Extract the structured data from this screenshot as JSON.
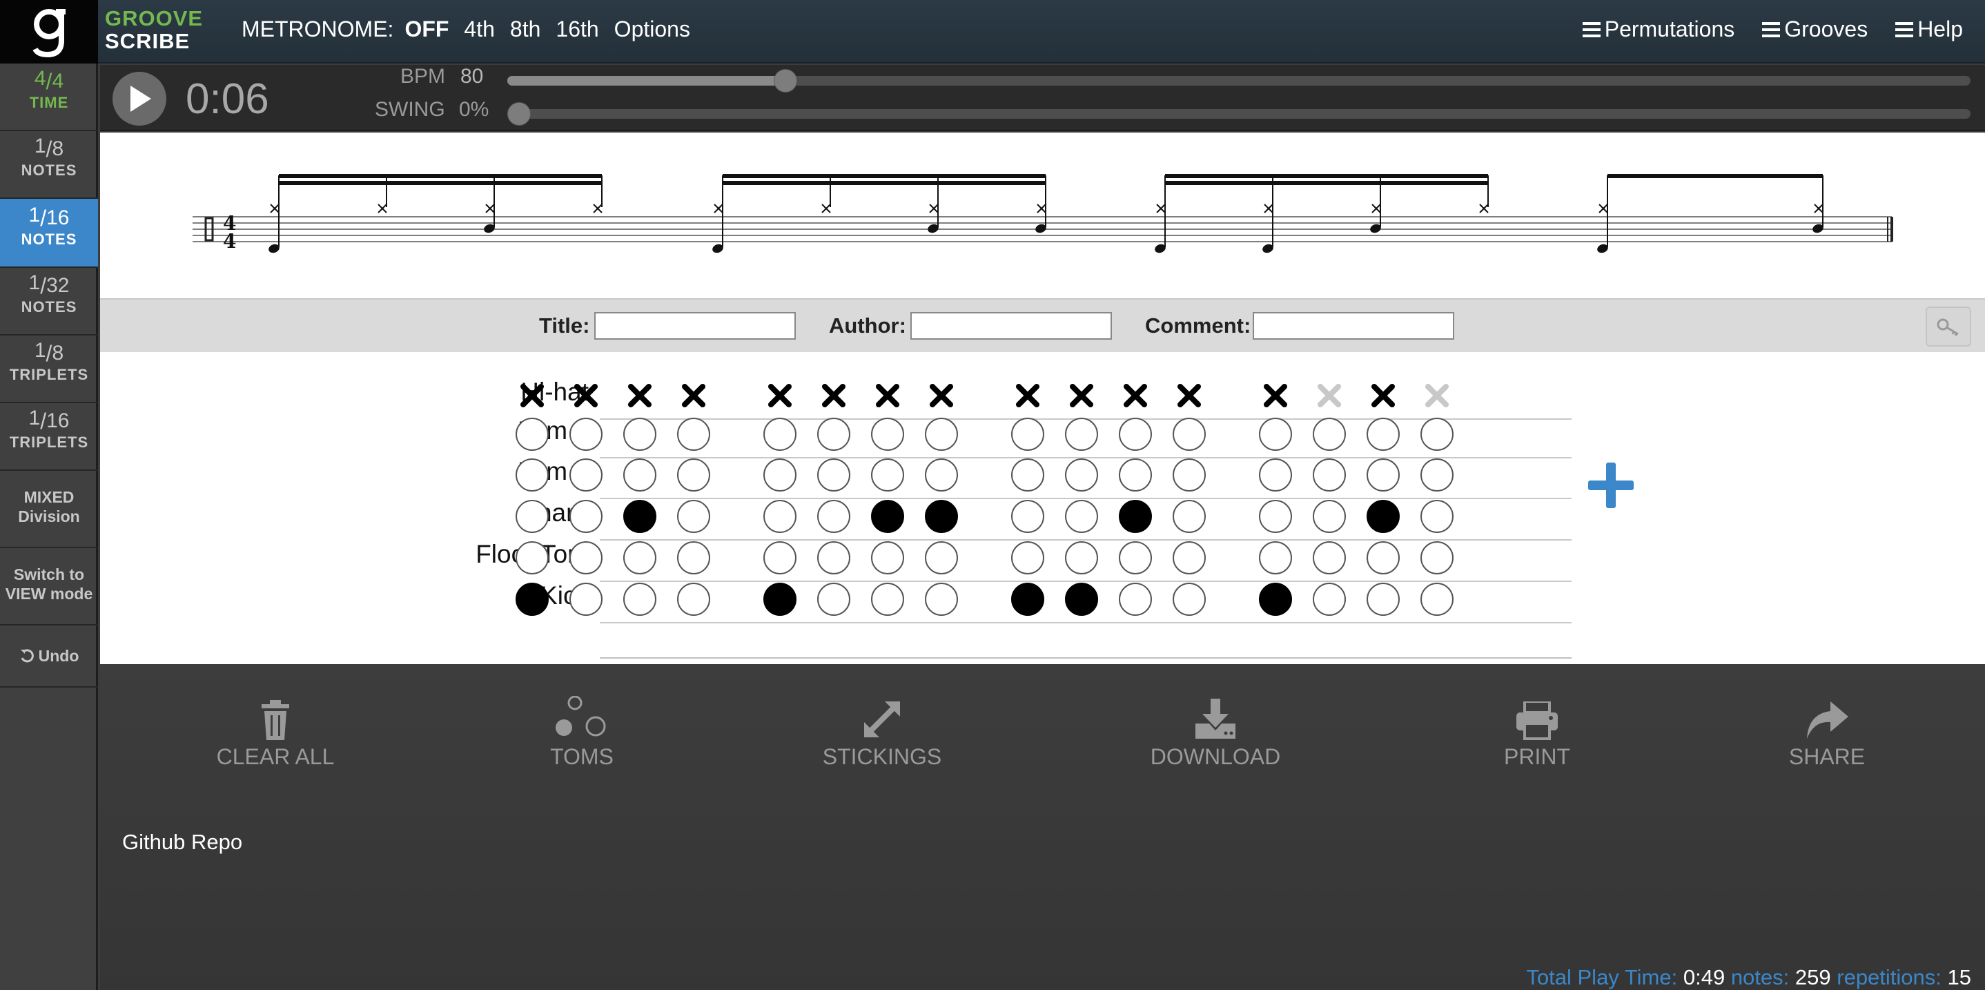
{
  "header": {
    "logo_letter": "g",
    "brand_line1": "GROOVE",
    "brand_line2": "SCRIBE",
    "metronome_label": "METRONOME:",
    "metronome_options": [
      "OFF",
      "4th",
      "8th",
      "16th",
      "Options"
    ],
    "menu": [
      "Permutations",
      "Grooves",
      "Help"
    ]
  },
  "sidebar": {
    "time": {
      "num": "4",
      "den": "4",
      "label": "TIME"
    },
    "divisions": [
      {
        "num": "1",
        "den": "8",
        "label": "NOTES"
      },
      {
        "num": "1",
        "den": "16",
        "label": "NOTES"
      },
      {
        "num": "1",
        "den": "32",
        "label": "NOTES"
      },
      {
        "num": "1",
        "den": "8",
        "label": "TRIPLETS"
      },
      {
        "num": "1",
        "den": "16",
        "label": "TRIPLETS"
      }
    ],
    "mixed": [
      "MIXED",
      "Division"
    ],
    "switch": [
      "Switch to",
      "VIEW mode"
    ],
    "undo": "Undo"
  },
  "player": {
    "time": "0:06",
    "bpm_label": "BPM",
    "bpm_value": "80",
    "bpm_fraction": 0.19,
    "swing_label": "SWING",
    "swing_value": "0%",
    "swing_fraction": 0.0
  },
  "meta": {
    "title_label": "Title:",
    "author_label": "Author:",
    "comment_label": "Comment:",
    "title_value": "",
    "author_value": "",
    "comment_value": ""
  },
  "grid": {
    "rows": [
      "Hi-hat",
      "Tom 1",
      "Tom 2",
      "Snare",
      "Floor Tom",
      "Kick"
    ],
    "hihat": [
      1,
      1,
      1,
      1,
      1,
      1,
      1,
      1,
      1,
      1,
      1,
      1,
      1,
      0,
      1,
      0
    ],
    "tom1": [
      0,
      0,
      0,
      0,
      0,
      0,
      0,
      0,
      0,
      0,
      0,
      0,
      0,
      0,
      0,
      0
    ],
    "tom2": [
      0,
      0,
      0,
      0,
      0,
      0,
      0,
      0,
      0,
      0,
      0,
      0,
      0,
      0,
      0,
      0
    ],
    "snare": [
      0,
      0,
      1,
      0,
      0,
      0,
      1,
      1,
      0,
      0,
      1,
      0,
      0,
      0,
      1,
      0
    ],
    "floortom": [
      0,
      0,
      0,
      0,
      0,
      0,
      0,
      0,
      0,
      0,
      0,
      0,
      0,
      0,
      0,
      0
    ],
    "kick": [
      1,
      0,
      0,
      0,
      1,
      0,
      0,
      0,
      1,
      1,
      0,
      0,
      1,
      0,
      0,
      0
    ]
  },
  "toolbar": {
    "clear_all": "CLEAR ALL",
    "toms": "TOMS",
    "stickings": "STICKINGS",
    "download": "DOWNLOAD",
    "print": "PRINT",
    "share": "SHARE"
  },
  "footer": {
    "github": "Github Repo",
    "total_label": "Total Play Time:",
    "total_value": "0:49",
    "notes_label": "notes:",
    "notes_value": "259",
    "reps_label": "repetitions:",
    "reps_value": "15"
  },
  "colors": {
    "accent_blue": "#3b87c9",
    "brand_green": "#74b94f",
    "header_bg": "#2c3a46"
  }
}
